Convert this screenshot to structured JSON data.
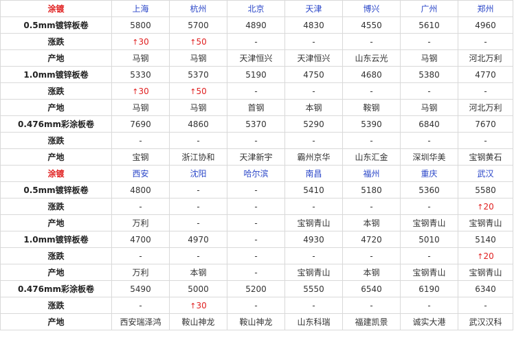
{
  "colors": {
    "section": "#e02020",
    "city": "#2a46c8",
    "rise": "#e02020"
  },
  "blocks": [
    {
      "section_label": "涂镀",
      "cities": [
        "上海",
        "杭州",
        "北京",
        "天津",
        "博兴",
        "广州",
        "郑州"
      ],
      "rows": [
        {
          "label": "0.5mm镀锌板卷",
          "type": "price",
          "cells": [
            "5800",
            "5700",
            "4890",
            "4830",
            "4550",
            "5610",
            "4960"
          ]
        },
        {
          "label": "涨跌",
          "type": "change",
          "cells": [
            "30",
            "50",
            "-",
            "-",
            "-",
            "-",
            "-"
          ]
        },
        {
          "label": "产地",
          "type": "origin",
          "cells": [
            "马钢",
            "马钢",
            "天津恒兴",
            "天津恒兴",
            "山东云光",
            "马钢",
            "河北万利"
          ]
        },
        {
          "label": "1.0mm镀锌板卷",
          "type": "price",
          "cells": [
            "5330",
            "5370",
            "5190",
            "4750",
            "4680",
            "5380",
            "4770"
          ]
        },
        {
          "label": "涨跌",
          "type": "change",
          "cells": [
            "30",
            "50",
            "-",
            "-",
            "-",
            "-",
            "-"
          ]
        },
        {
          "label": "产地",
          "type": "origin",
          "cells": [
            "马钢",
            "马钢",
            "首钢",
            "本钢",
            "鞍钢",
            "马钢",
            "河北万利"
          ]
        },
        {
          "label": "0.476mm彩涂板卷",
          "type": "price",
          "cells": [
            "7690",
            "4860",
            "5370",
            "5290",
            "5390",
            "6840",
            "7670"
          ]
        },
        {
          "label": "涨跌",
          "type": "change",
          "cells": [
            "-",
            "-",
            "-",
            "-",
            "-",
            "-",
            "-"
          ]
        },
        {
          "label": "产地",
          "type": "origin",
          "cells": [
            "宝钢",
            "浙江协和",
            "天津新宇",
            "霸州京华",
            "山东汇金",
            "深圳华美",
            "宝钢黄石"
          ]
        }
      ]
    },
    {
      "section_label": "涂镀",
      "cities": [
        "西安",
        "沈阳",
        "哈尔滨",
        "南昌",
        "福州",
        "重庆",
        "武汉"
      ],
      "rows": [
        {
          "label": "0.5mm镀锌板卷",
          "type": "price",
          "cells": [
            "4800",
            "-",
            "-",
            "5410",
            "5180",
            "5360",
            "5580"
          ]
        },
        {
          "label": "涨跌",
          "type": "change",
          "cells": [
            "-",
            "-",
            "-",
            "-",
            "-",
            "-",
            "20"
          ]
        },
        {
          "label": "产地",
          "type": "origin",
          "cells": [
            "万利",
            "-",
            "-",
            "宝钢青山",
            "本钢",
            "宝钢青山",
            "宝钢青山"
          ]
        },
        {
          "label": "1.0mm镀锌板卷",
          "type": "price",
          "cells": [
            "4700",
            "4970",
            "-",
            "4930",
            "4720",
            "5010",
            "5140"
          ]
        },
        {
          "label": "涨跌",
          "type": "change",
          "cells": [
            "-",
            "-",
            "-",
            "-",
            "-",
            "-",
            "20"
          ]
        },
        {
          "label": "产地",
          "type": "origin",
          "cells": [
            "万利",
            "本钢",
            "-",
            "宝钢青山",
            "本钢",
            "宝钢青山",
            "宝钢青山"
          ]
        },
        {
          "label": "0.476mm彩涂板卷",
          "type": "price",
          "cells": [
            "5490",
            "5000",
            "5200",
            "5550",
            "6540",
            "6190",
            "6340"
          ]
        },
        {
          "label": "涨跌",
          "type": "change",
          "cells": [
            "-",
            "30",
            "-",
            "-",
            "-",
            "-",
            "-"
          ]
        },
        {
          "label": "产地",
          "type": "origin",
          "cells": [
            "西安瑞泽鸿",
            "鞍山神龙",
            "鞍山神龙",
            "山东科瑞",
            "福建凯景",
            "诚实大港",
            "武汉汉科"
          ]
        }
      ]
    }
  ]
}
